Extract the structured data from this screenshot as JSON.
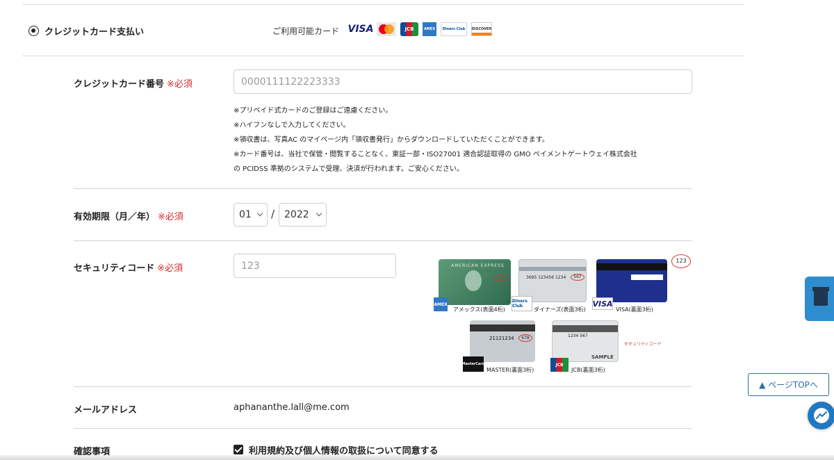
{
  "payment": {
    "method_label": "クレジットカード支払い",
    "available_cards_label": "ご利用可能カード",
    "brands": [
      "VISA",
      "MasterCard",
      "JCB",
      "AMERICAN EXPRESS",
      "Diners Club",
      "DISCOVER"
    ]
  },
  "card_number": {
    "label": "クレジットカード番号",
    "required": "※必須",
    "placeholder": "0000111122223333",
    "notes": [
      "※プリペイド式カードのご登録はご遠慮ください。",
      "※ハイフンなしで入力してください。",
      "※領収書は、写真AC のマイページ内「領収書発行」からダウンロードしていただくことができます。",
      "※カード番号は、当社で保管・閲覧することなく、東証一部・ISO27001 適合認証取得の GMO ペイメントゲートウェイ株式会社",
      "の PCIDSS 準拠のシステムで受理、決済が行われます。ご安心ください。"
    ]
  },
  "expiry": {
    "label": "有効期限（月／年）",
    "required": "※必須",
    "month": "01",
    "separator": "/",
    "year": "2022"
  },
  "security_code": {
    "label": "セキュリティコード",
    "required": "※必須",
    "placeholder": "123",
    "image": {
      "amex_caption": "アメックス(表面4桁)",
      "diners_caption": "ダイナーズ(表面3桁)",
      "visa_caption": "VISA(裏面3桁)",
      "master_caption": "MASTER(裏面3桁)",
      "jcb_caption": "JCB(裏面3桁)",
      "amex_card_text": "AMERICAN EXPRESS",
      "diners_card_number": "3695 123456 1234",
      "diners_code": "567",
      "visa_code": "123",
      "master_number": "21121234",
      "master_code": "678",
      "jcb_number": "1234 567",
      "jcb_pointer_label": "セキュリティコード",
      "jcb_sample": "SAMPLE",
      "logos": {
        "amex": "AMEX",
        "diners": "Diners Club",
        "visa": "VISA",
        "master": "MasterCard",
        "jcb": "JCB"
      }
    }
  },
  "email": {
    "label": "メールアドレス",
    "value": "aphananthe.lall@me.com"
  },
  "confirm": {
    "label": "確認事項",
    "agree_text": "利用規約及び個人情報の取扱について同意する"
  },
  "floating": {
    "page_top": "▲ ページTOPへ"
  }
}
